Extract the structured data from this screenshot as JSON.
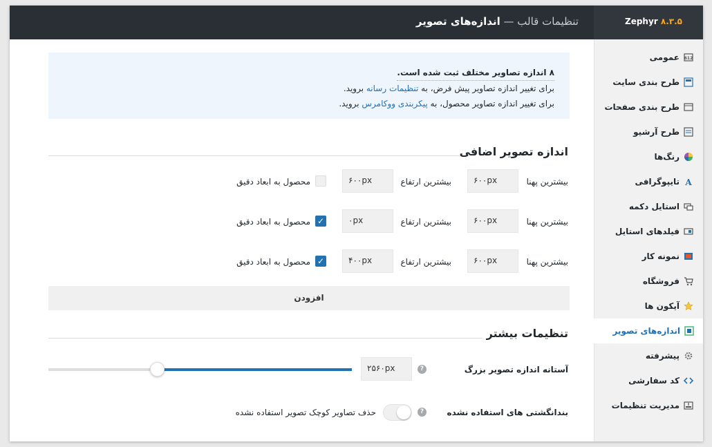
{
  "header": {
    "title_prefix": "تنظیمات قالب",
    "separator": " — ",
    "title_main": "اندازه‌های تصویر",
    "brand_name": "Zephyr",
    "brand_version": "۸.۳.۵"
  },
  "sidebar": {
    "items": [
      {
        "label": "عمومی",
        "icon": "general-icon"
      },
      {
        "label": "طرح بندی سایت",
        "icon": "site-layout-icon"
      },
      {
        "label": "طرح بندی صفحات",
        "icon": "page-layout-icon"
      },
      {
        "label": "طرح آرشیو",
        "icon": "archive-layout-icon"
      },
      {
        "label": "رنگ‌ها",
        "icon": "color-wheel-icon"
      },
      {
        "label": "تایپوگرافی",
        "icon": "typography-icon"
      },
      {
        "label": "استایل دکمه",
        "icon": "button-style-icon"
      },
      {
        "label": "فیلدهای استایل",
        "icon": "fields-style-icon"
      },
      {
        "label": "نمونه کار",
        "icon": "portfolio-icon"
      },
      {
        "label": "فروشگاه",
        "icon": "cart-icon"
      },
      {
        "label": "آیکون ها",
        "icon": "star-icon"
      },
      {
        "label": "اندازه‌های تصویر",
        "icon": "image-sizes-icon",
        "active": true
      },
      {
        "label": "پیشرفته",
        "icon": "gear-icon"
      },
      {
        "label": "کد سفارشی",
        "icon": "code-icon"
      },
      {
        "label": "مدیریت تنظیمات",
        "icon": "manage-settings-icon"
      }
    ]
  },
  "notice": {
    "line1": "۸ اندازه تصاویر مختلف ثبت شده است.",
    "line2_before": "برای تغییر اندازه تصاویر پیش فرض، به ",
    "line2_link": "تنظیمات رسانه",
    "line2_after": " بروید.",
    "line3_before": "برای تغییر اندازه تصاویر محصول، به ",
    "line3_link": "پیکربندی ووکامرس",
    "line3_after": " بروید."
  },
  "extra_sizes": {
    "heading": "اندازه تصویر اضافی",
    "max_width_label": "بیشترین پهنا",
    "max_height_label": "بیشترین ارتفاع",
    "crop_label": "محصول به ابعاد دقیق",
    "rows": [
      {
        "width": "۶۰۰px",
        "height": "۶۰۰px",
        "crop": false
      },
      {
        "width": "۶۰۰px",
        "height": "۰px",
        "crop": true
      },
      {
        "width": "۶۰۰px",
        "height": "۴۰۰px",
        "crop": true
      }
    ],
    "add_label": "افزودن"
  },
  "more_settings": {
    "heading": "تنظیمات بیشتر",
    "threshold_label": "آستانه اندازه تصویر بزرگ",
    "threshold_value": "۲۵۶۰px",
    "threshold_fraction": 0.64,
    "unused_label": "بندانگشتی های استفاده نشده",
    "unused_toggle_label": "حذف تصاویر کوچک تصویر استفاده نشده",
    "unused_toggle_on": false
  },
  "colors": {
    "accent": "#2271b1",
    "header_bg": "#2a2f36",
    "brand_version": "#f6a623"
  }
}
